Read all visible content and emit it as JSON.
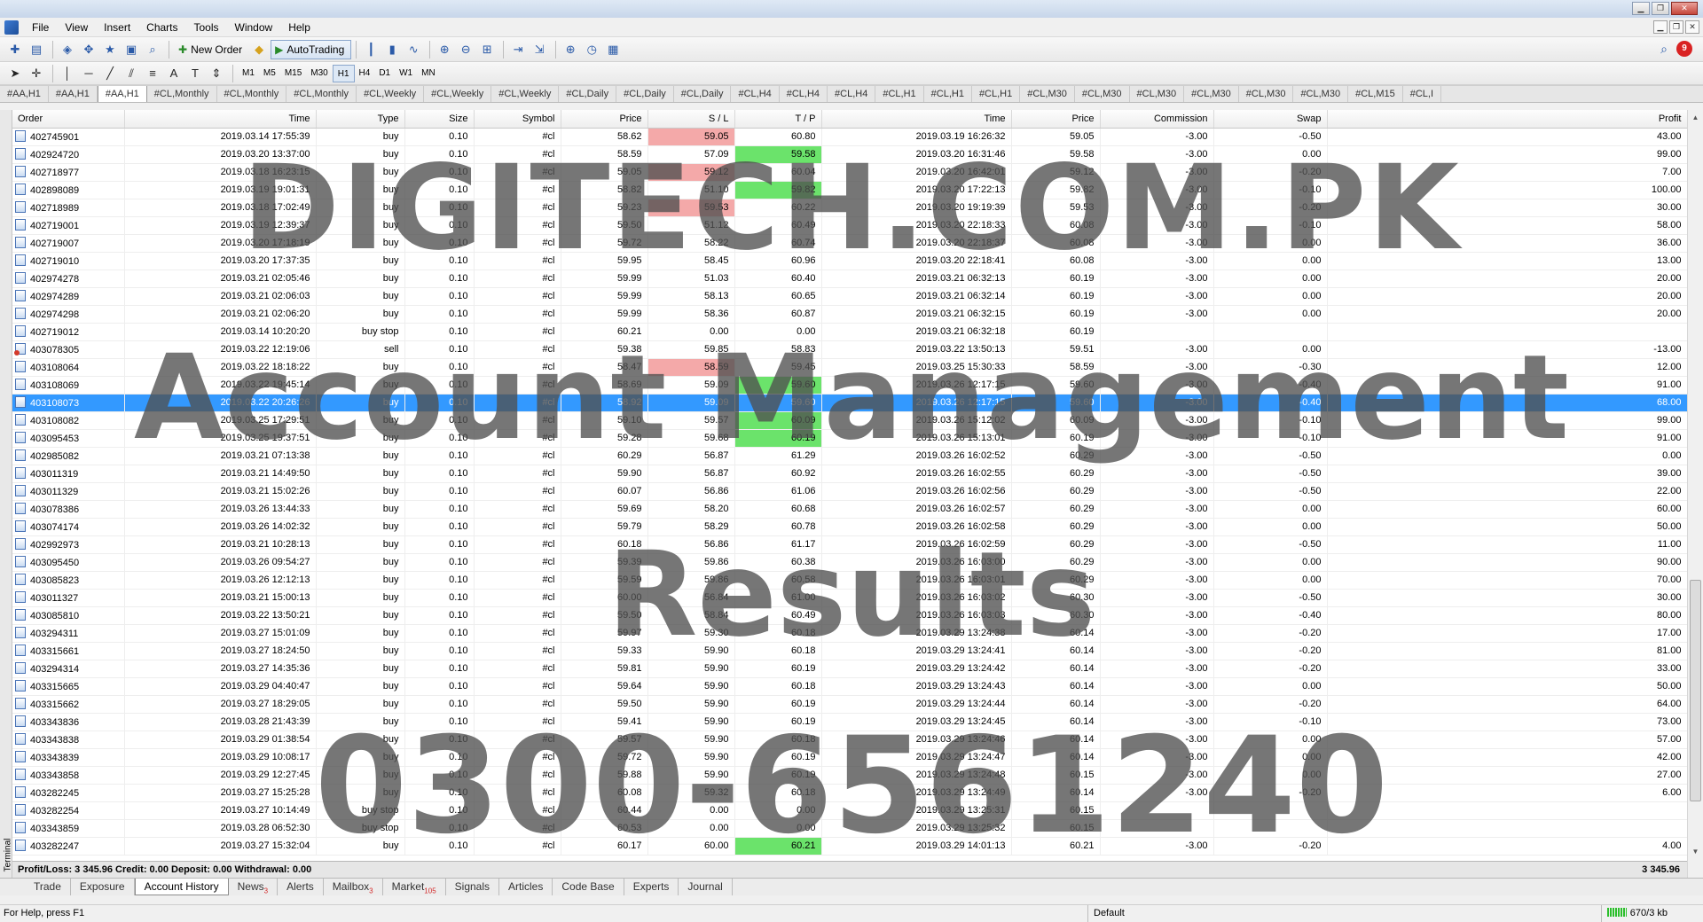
{
  "menu": [
    "File",
    "View",
    "Insert",
    "Charts",
    "Tools",
    "Window",
    "Help"
  ],
  "toolbar": {
    "new_order": "New Order",
    "auto_trading": "AutoTrading",
    "timeframes": [
      "M1",
      "M5",
      "M15",
      "M30",
      "H1",
      "H4",
      "D1",
      "W1",
      "MN"
    ],
    "active_timeframe": "H1",
    "notifications": "9"
  },
  "chart_tabs": [
    "#AA,H1",
    "#AA,H1",
    "#AA,H1",
    "#CL,Monthly",
    "#CL,Monthly",
    "#CL,Monthly",
    "#CL,Weekly",
    "#CL,Weekly",
    "#CL,Weekly",
    "#CL,Daily",
    "#CL,Daily",
    "#CL,Daily",
    "#CL,H4",
    "#CL,H4",
    "#CL,H4",
    "#CL,H1",
    "#CL,H1",
    "#CL,H1",
    "#CL,M30",
    "#CL,M30",
    "#CL,M30",
    "#CL,M30",
    "#CL,M30",
    "#CL,M30",
    "#CL,M15",
    "#CL,I"
  ],
  "active_chart_tab": 2,
  "columns": [
    "Order",
    "Time",
    "Type",
    "Size",
    "Symbol",
    "Price",
    "S / L",
    "T / P",
    "Time",
    "Price",
    "Commission",
    "Swap",
    "Profit"
  ],
  "rows": [
    {
      "order": "402745901",
      "open_time": "2019.03.14 17:55:39",
      "type": "buy",
      "size": "0.10",
      "symbol": "#cl",
      "price": "58.62",
      "sl": "59.05",
      "tp": "60.80",
      "close_time": "2019.03.19 16:26:32",
      "close_price": "59.05",
      "commission": "-3.00",
      "swap": "-0.50",
      "profit": "43.00",
      "sl_hl": "red"
    },
    {
      "order": "402924720",
      "open_time": "2019.03.20 13:37:00",
      "type": "buy",
      "size": "0.10",
      "symbol": "#cl",
      "price": "58.59",
      "sl": "57.09",
      "tp": "59.58",
      "close_time": "2019.03.20 16:31:46",
      "close_price": "59.58",
      "commission": "-3.00",
      "swap": "0.00",
      "profit": "99.00",
      "tp_hl": "green"
    },
    {
      "order": "402718977",
      "open_time": "2019.03.18 16:23:15",
      "type": "buy",
      "size": "0.10",
      "symbol": "#cl",
      "price": "59.05",
      "sl": "59.12",
      "tp": "60.04",
      "close_time": "2019.03.20 16:42:01",
      "close_price": "59.12",
      "commission": "-3.00",
      "swap": "-0.20",
      "profit": "7.00",
      "sl_hl": "red"
    },
    {
      "order": "402898089",
      "open_time": "2019.03.19 19:01:31",
      "type": "buy",
      "size": "0.10",
      "symbol": "#cl",
      "price": "58.82",
      "sl": "51.10",
      "tp": "59.82",
      "close_time": "2019.03.20 17:22:13",
      "close_price": "59.82",
      "commission": "-3.00",
      "swap": "-0.10",
      "profit": "100.00",
      "tp_hl": "green"
    },
    {
      "order": "402718989",
      "open_time": "2019.03.18 17:02:49",
      "type": "buy",
      "size": "0.10",
      "symbol": "#cl",
      "price": "59.23",
      "sl": "59.53",
      "tp": "60.22",
      "close_time": "2019.03.20 19:19:39",
      "close_price": "59.53",
      "commission": "-3.00",
      "swap": "-0.20",
      "profit": "30.00",
      "sl_hl": "red"
    },
    {
      "order": "402719001",
      "open_time": "2019.03.19 12:39:37",
      "type": "buy",
      "size": "0.10",
      "symbol": "#cl",
      "price": "59.50",
      "sl": "51.12",
      "tp": "60.49",
      "close_time": "2019.03.20 22:18:33",
      "close_price": "60.08",
      "commission": "-3.00",
      "swap": "-0.10",
      "profit": "58.00"
    },
    {
      "order": "402719007",
      "open_time": "2019.03.20 17:18:19",
      "type": "buy",
      "size": "0.10",
      "symbol": "#cl",
      "price": "59.72",
      "sl": "58.22",
      "tp": "60.74",
      "close_time": "2019.03.20 22:18:37",
      "close_price": "60.08",
      "commission": "-3.00",
      "swap": "0.00",
      "profit": "36.00"
    },
    {
      "order": "402719010",
      "open_time": "2019.03.20 17:37:35",
      "type": "buy",
      "size": "0.10",
      "symbol": "#cl",
      "price": "59.95",
      "sl": "58.45",
      "tp": "60.96",
      "close_time": "2019.03.20 22:18:41",
      "close_price": "60.08",
      "commission": "-3.00",
      "swap": "0.00",
      "profit": "13.00"
    },
    {
      "order": "402974278",
      "open_time": "2019.03.21 02:05:46",
      "type": "buy",
      "size": "0.10",
      "symbol": "#cl",
      "price": "59.99",
      "sl": "51.03",
      "tp": "60.40",
      "close_time": "2019.03.21 06:32:13",
      "close_price": "60.19",
      "commission": "-3.00",
      "swap": "0.00",
      "profit": "20.00"
    },
    {
      "order": "402974289",
      "open_time": "2019.03.21 02:06:03",
      "type": "buy",
      "size": "0.10",
      "symbol": "#cl",
      "price": "59.99",
      "sl": "58.13",
      "tp": "60.65",
      "close_time": "2019.03.21 06:32:14",
      "close_price": "60.19",
      "commission": "-3.00",
      "swap": "0.00",
      "profit": "20.00"
    },
    {
      "order": "402974298",
      "open_time": "2019.03.21 02:06:20",
      "type": "buy",
      "size": "0.10",
      "symbol": "#cl",
      "price": "59.99",
      "sl": "58.36",
      "tp": "60.87",
      "close_time": "2019.03.21 06:32:15",
      "close_price": "60.19",
      "commission": "-3.00",
      "swap": "0.00",
      "profit": "20.00"
    },
    {
      "order": "402719012",
      "open_time": "2019.03.14 10:20:20",
      "type": "buy stop",
      "size": "0.10",
      "symbol": "#cl",
      "price": "60.21",
      "sl": "0.00",
      "tp": "0.00",
      "close_time": "2019.03.21 06:32:18",
      "close_price": "60.19",
      "commission": "",
      "swap": "",
      "profit": ""
    },
    {
      "order": "403078305",
      "open_time": "2019.03.22 12:19:06",
      "type": "sell",
      "size": "0.10",
      "symbol": "#cl",
      "price": "59.38",
      "sl": "59.85",
      "tp": "58.83",
      "close_time": "2019.03.22 13:50:13",
      "close_price": "59.51",
      "commission": "-3.00",
      "swap": "0.00",
      "profit": "-13.00",
      "icon": "red"
    },
    {
      "order": "403108064",
      "open_time": "2019.03.22 18:18:22",
      "type": "buy",
      "size": "0.10",
      "symbol": "#cl",
      "price": "58.47",
      "sl": "58.59",
      "tp": "59.45",
      "close_time": "2019.03.25 15:30:33",
      "close_price": "58.59",
      "commission": "-3.00",
      "swap": "-0.30",
      "profit": "12.00",
      "sl_hl": "red"
    },
    {
      "order": "403108069",
      "open_time": "2019.03.22 19:45:14",
      "type": "buy",
      "size": "0.10",
      "symbol": "#cl",
      "price": "58.69",
      "sl": "59.09",
      "tp": "59.60",
      "close_time": "2019.03.26 12:17:15",
      "close_price": "59.60",
      "commission": "-3.00",
      "swap": "-0.40",
      "profit": "91.00",
      "tp_hl": "green"
    },
    {
      "order": "403108073",
      "open_time": "2019.03.22 20:26:26",
      "type": "buy",
      "size": "0.10",
      "symbol": "#cl",
      "price": "58.92",
      "sl": "59.09",
      "tp": "59.60",
      "close_time": "2019.03.26 12:17:15",
      "close_price": "59.60",
      "commission": "-3.00",
      "swap": "-0.40",
      "profit": "68.00",
      "selected": true
    },
    {
      "order": "403108082",
      "open_time": "2019.03.25 17:29:51",
      "type": "buy",
      "size": "0.10",
      "symbol": "#cl",
      "price": "59.10",
      "sl": "59.57",
      "tp": "60.09",
      "close_time": "2019.03.26 15:12:02",
      "close_price": "60.09",
      "commission": "-3.00",
      "swap": "-0.10",
      "profit": "99.00",
      "tp_hl": "green"
    },
    {
      "order": "403095453",
      "open_time": "2019.03.25 19:37:51",
      "type": "buy",
      "size": "0.10",
      "symbol": "#cl",
      "price": "59.28",
      "sl": "59.68",
      "tp": "60.19",
      "close_time": "2019.03.26 15:13:01",
      "close_price": "60.19",
      "commission": "-3.00",
      "swap": "-0.10",
      "profit": "91.00",
      "tp_hl": "green"
    },
    {
      "order": "402985082",
      "open_time": "2019.03.21 07:13:38",
      "type": "buy",
      "size": "0.10",
      "symbol": "#cl",
      "price": "60.29",
      "sl": "56.87",
      "tp": "61.29",
      "close_time": "2019.03.26 16:02:52",
      "close_price": "60.29",
      "commission": "-3.00",
      "swap": "-0.50",
      "profit": "0.00"
    },
    {
      "order": "403011319",
      "open_time": "2019.03.21 14:49:50",
      "type": "buy",
      "size": "0.10",
      "symbol": "#cl",
      "price": "59.90",
      "sl": "56.87",
      "tp": "60.92",
      "close_time": "2019.03.26 16:02:55",
      "close_price": "60.29",
      "commission": "-3.00",
      "swap": "-0.50",
      "profit": "39.00"
    },
    {
      "order": "403011329",
      "open_time": "2019.03.21 15:02:26",
      "type": "buy",
      "size": "0.10",
      "symbol": "#cl",
      "price": "60.07",
      "sl": "56.86",
      "tp": "61.06",
      "close_time": "2019.03.26 16:02:56",
      "close_price": "60.29",
      "commission": "-3.00",
      "swap": "-0.50",
      "profit": "22.00"
    },
    {
      "order": "403078386",
      "open_time": "2019.03.26 13:44:33",
      "type": "buy",
      "size": "0.10",
      "symbol": "#cl",
      "price": "59.69",
      "sl": "58.20",
      "tp": "60.68",
      "close_time": "2019.03.26 16:02:57",
      "close_price": "60.29",
      "commission": "-3.00",
      "swap": "0.00",
      "profit": "60.00"
    },
    {
      "order": "403074174",
      "open_time": "2019.03.26 14:02:32",
      "type": "buy",
      "size": "0.10",
      "symbol": "#cl",
      "price": "59.79",
      "sl": "58.29",
      "tp": "60.78",
      "close_time": "2019.03.26 16:02:58",
      "close_price": "60.29",
      "commission": "-3.00",
      "swap": "0.00",
      "profit": "50.00"
    },
    {
      "order": "402992973",
      "open_time": "2019.03.21 10:28:13",
      "type": "buy",
      "size": "0.10",
      "symbol": "#cl",
      "price": "60.18",
      "sl": "56.86",
      "tp": "61.17",
      "close_time": "2019.03.26 16:02:59",
      "close_price": "60.29",
      "commission": "-3.00",
      "swap": "-0.50",
      "profit": "11.00"
    },
    {
      "order": "403095450",
      "open_time": "2019.03.26 09:54:27",
      "type": "buy",
      "size": "0.10",
      "symbol": "#cl",
      "price": "59.39",
      "sl": "59.86",
      "tp": "60.38",
      "close_time": "2019.03.26 16:03:00",
      "close_price": "60.29",
      "commission": "-3.00",
      "swap": "0.00",
      "profit": "90.00"
    },
    {
      "order": "403085823",
      "open_time": "2019.03.26 12:12:13",
      "type": "buy",
      "size": "0.10",
      "symbol": "#cl",
      "price": "59.59",
      "sl": "59.86",
      "tp": "60.58",
      "close_time": "2019.03.26 16:03:01",
      "close_price": "60.29",
      "commission": "-3.00",
      "swap": "0.00",
      "profit": "70.00"
    },
    {
      "order": "403011327",
      "open_time": "2019.03.21 15:00:13",
      "type": "buy",
      "size": "0.10",
      "symbol": "#cl",
      "price": "60.00",
      "sl": "56.84",
      "tp": "61.00",
      "close_time": "2019.03.26 16:03:02",
      "close_price": "60.30",
      "commission": "-3.00",
      "swap": "-0.50",
      "profit": "30.00"
    },
    {
      "order": "403085810",
      "open_time": "2019.03.22 13:50:21",
      "type": "buy",
      "size": "0.10",
      "symbol": "#cl",
      "price": "59.50",
      "sl": "58.84",
      "tp": "60.49",
      "close_time": "2019.03.26 16:03:03",
      "close_price": "60.30",
      "commission": "-3.00",
      "swap": "-0.40",
      "profit": "80.00"
    },
    {
      "order": "403294311",
      "open_time": "2019.03.27 15:01:09",
      "type": "buy",
      "size": "0.10",
      "symbol": "#cl",
      "price": "59.97",
      "sl": "59.30",
      "tp": "60.18",
      "close_time": "2019.03.29 13:24:38",
      "close_price": "60.14",
      "commission": "-3.00",
      "swap": "-0.20",
      "profit": "17.00"
    },
    {
      "order": "403315661",
      "open_time": "2019.03.27 18:24:50",
      "type": "buy",
      "size": "0.10",
      "symbol": "#cl",
      "price": "59.33",
      "sl": "59.90",
      "tp": "60.18",
      "close_time": "2019.03.29 13:24:41",
      "close_price": "60.14",
      "commission": "-3.00",
      "swap": "-0.20",
      "profit": "81.00"
    },
    {
      "order": "403294314",
      "open_time": "2019.03.27 14:35:36",
      "type": "buy",
      "size": "0.10",
      "symbol": "#cl",
      "price": "59.81",
      "sl": "59.90",
      "tp": "60.19",
      "close_time": "2019.03.29 13:24:42",
      "close_price": "60.14",
      "commission": "-3.00",
      "swap": "-0.20",
      "profit": "33.00"
    },
    {
      "order": "403315665",
      "open_time": "2019.03.29 04:40:47",
      "type": "buy",
      "size": "0.10",
      "symbol": "#cl",
      "price": "59.64",
      "sl": "59.90",
      "tp": "60.18",
      "close_time": "2019.03.29 13:24:43",
      "close_price": "60.14",
      "commission": "-3.00",
      "swap": "0.00",
      "profit": "50.00"
    },
    {
      "order": "403315662",
      "open_time": "2019.03.27 18:29:05",
      "type": "buy",
      "size": "0.10",
      "symbol": "#cl",
      "price": "59.50",
      "sl": "59.90",
      "tp": "60.19",
      "close_time": "2019.03.29 13:24:44",
      "close_price": "60.14",
      "commission": "-3.00",
      "swap": "-0.20",
      "profit": "64.00"
    },
    {
      "order": "403343836",
      "open_time": "2019.03.28 21:43:39",
      "type": "buy",
      "size": "0.10",
      "symbol": "#cl",
      "price": "59.41",
      "sl": "59.90",
      "tp": "60.19",
      "close_time": "2019.03.29 13:24:45",
      "close_price": "60.14",
      "commission": "-3.00",
      "swap": "-0.10",
      "profit": "73.00"
    },
    {
      "order": "403343838",
      "open_time": "2019.03.29 01:38:54",
      "type": "buy",
      "size": "0.10",
      "symbol": "#cl",
      "price": "59.57",
      "sl": "59.90",
      "tp": "60.18",
      "close_time": "2019.03.29 13:24:46",
      "close_price": "60.14",
      "commission": "-3.00",
      "swap": "0.00",
      "profit": "57.00"
    },
    {
      "order": "403343839",
      "open_time": "2019.03.29 10:08:17",
      "type": "buy",
      "size": "0.10",
      "symbol": "#cl",
      "price": "59.72",
      "sl": "59.90",
      "tp": "60.19",
      "close_time": "2019.03.29 13:24:47",
      "close_price": "60.14",
      "commission": "-3.00",
      "swap": "0.00",
      "profit": "42.00"
    },
    {
      "order": "403343858",
      "open_time": "2019.03.29 12:27:45",
      "type": "buy",
      "size": "0.10",
      "symbol": "#cl",
      "price": "59.88",
      "sl": "59.90",
      "tp": "60.19",
      "close_time": "2019.03.29 13:24:48",
      "close_price": "60.15",
      "commission": "-3.00",
      "swap": "0.00",
      "profit": "27.00"
    },
    {
      "order": "403282245",
      "open_time": "2019.03.27 15:25:28",
      "type": "buy",
      "size": "0.10",
      "symbol": "#cl",
      "price": "60.08",
      "sl": "59.32",
      "tp": "60.18",
      "close_time": "2019.03.29 13:24:49",
      "close_price": "60.14",
      "commission": "-3.00",
      "swap": "-0.20",
      "profit": "6.00"
    },
    {
      "order": "403282254",
      "open_time": "2019.03.27 10:14:49",
      "type": "buy stop",
      "size": "0.10",
      "symbol": "#cl",
      "price": "60.44",
      "sl": "0.00",
      "tp": "0.00",
      "close_time": "2019.03.29 13:25:31",
      "close_price": "60.15",
      "commission": "",
      "swap": "",
      "profit": ""
    },
    {
      "order": "403343859",
      "open_time": "2019.03.28 06:52:30",
      "type": "buy stop",
      "size": "0.10",
      "symbol": "#cl",
      "price": "60.53",
      "sl": "0.00",
      "tp": "0.00",
      "close_time": "2019.03.29 13:25:32",
      "close_price": "60.15",
      "commission": "",
      "swap": "",
      "profit": ""
    },
    {
      "order": "403282247",
      "open_time": "2019.03.27 15:32:04",
      "type": "buy",
      "size": "0.10",
      "symbol": "#cl",
      "price": "60.17",
      "sl": "60.00",
      "tp": "60.21",
      "close_time": "2019.03.29 14:01:13",
      "close_price": "60.21",
      "commission": "-3.00",
      "swap": "-0.20",
      "profit": "4.00",
      "tp_hl": "green"
    }
  ],
  "summary": {
    "text": "Profit/Loss: 3 345.96  Credit: 0.00  Deposit: 0.00  Withdrawal: 0.00",
    "total": "3 345.96"
  },
  "terminal_label": "Terminal",
  "bottom_tabs": [
    {
      "label": "Trade"
    },
    {
      "label": "Exposure"
    },
    {
      "label": "Account History",
      "active": true
    },
    {
      "label": "News",
      "badge": "3"
    },
    {
      "label": "Alerts"
    },
    {
      "label": "Mailbox",
      "badge": "3"
    },
    {
      "label": "Market",
      "badge": "105"
    },
    {
      "label": "Signals"
    },
    {
      "label": "Articles"
    },
    {
      "label": "Code Base"
    },
    {
      "label": "Experts"
    },
    {
      "label": "Journal"
    }
  ],
  "status": {
    "help": "For Help, press F1",
    "profile": "Default",
    "traffic": "670/3 kb"
  },
  "watermark": {
    "line1": "DIGITECH.COM.PK",
    "line2": "Account Management",
    "line3": "Results",
    "line4": "0300-6561240"
  },
  "colors": {
    "selected_row": "#3399ff",
    "sl_hit": "#f4a9a9",
    "tp_hit": "#6be36b"
  }
}
